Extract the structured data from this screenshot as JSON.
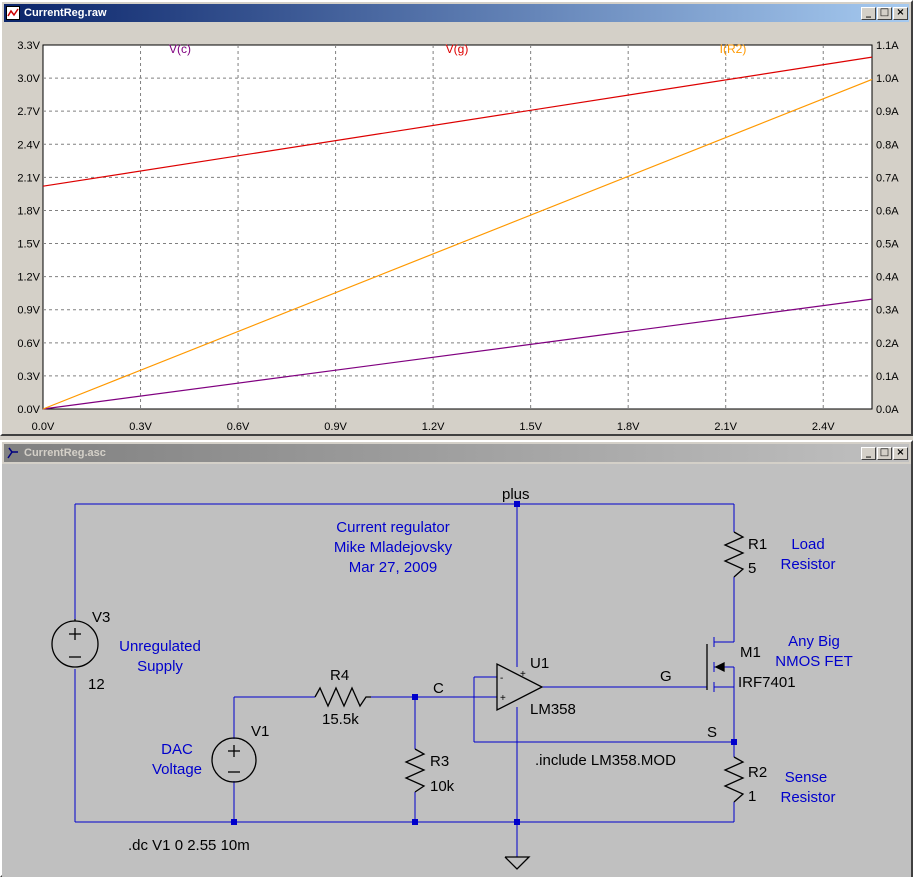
{
  "waveform_window": {
    "title": "CurrentReg.raw",
    "buttons": [
      "_",
      "□",
      "×"
    ]
  },
  "schematic_window": {
    "title": "CurrentReg.asc",
    "buttons": [
      "_",
      "□",
      "×"
    ]
  },
  "chart_data": {
    "type": "line",
    "x": [
      0,
      2.55
    ],
    "xlim": [
      0,
      2.55
    ],
    "xticks": [
      "0.0V",
      "0.3V",
      "0.6V",
      "0.9V",
      "1.2V",
      "1.5V",
      "1.8V",
      "2.1V",
      "2.4V"
    ],
    "xtick_values": [
      0,
      0.3,
      0.6,
      0.9,
      1.2,
      1.5,
      1.8,
      2.1,
      2.4
    ],
    "ylim_left": [
      0,
      3.3
    ],
    "yticks_left": [
      "0.0V",
      "0.3V",
      "0.6V",
      "0.9V",
      "1.2V",
      "1.5V",
      "1.8V",
      "2.1V",
      "2.4V",
      "2.7V",
      "3.0V",
      "3.3V"
    ],
    "ylim_right": [
      0,
      1.1
    ],
    "yticks_right": [
      "0.0A",
      "0.1A",
      "0.2A",
      "0.3A",
      "0.4A",
      "0.5A",
      "0.6A",
      "0.7A",
      "0.8A",
      "0.9A",
      "1.0A",
      "1.1A"
    ],
    "grid": true,
    "series": [
      {
        "name": "V(c)",
        "axis": "left",
        "color": "#800080",
        "x": [
          0,
          2.55
        ],
        "y": [
          0,
          0.996
        ]
      },
      {
        "name": "V(g)",
        "axis": "left",
        "color": "#dd0000",
        "x": [
          0,
          2.55
        ],
        "y": [
          2.02,
          3.19
        ]
      },
      {
        "name": "I(R2)",
        "axis": "right",
        "color": "#ff9900",
        "x": [
          0,
          2.55
        ],
        "y": [
          0,
          0.996
        ]
      }
    ]
  },
  "schematic": {
    "nodes": {
      "plus": "plus",
      "c": "C",
      "g": "G",
      "s": "S"
    },
    "comment": [
      "Current regulator",
      "Mike Mladejovsky",
      "Mar 27, 2009"
    ],
    "v3": {
      "name": "V3",
      "value": "12",
      "desc": [
        "Unregulated",
        "Supply"
      ]
    },
    "v1": {
      "name": "V1",
      "desc": [
        "DAC",
        "Voltage"
      ]
    },
    "r4": {
      "name": "R4",
      "value": "15.5k"
    },
    "r3": {
      "name": "R3",
      "value": "10k"
    },
    "r1": {
      "name": "R1",
      "value": "5",
      "desc": [
        "Load",
        "Resistor"
      ]
    },
    "r2": {
      "name": "R2",
      "value": "1",
      "desc": [
        "Sense",
        "Resistor"
      ]
    },
    "u1": {
      "name": "U1",
      "value": "LM358",
      "plus": "+",
      "minus": "-"
    },
    "m1": {
      "name": "M1",
      "value": "IRF7401",
      "desc": [
        "Any Big",
        "NMOS FET"
      ]
    },
    "include": ".include LM358.MOD",
    "dc": ".dc V1 0 2.55 10m"
  }
}
